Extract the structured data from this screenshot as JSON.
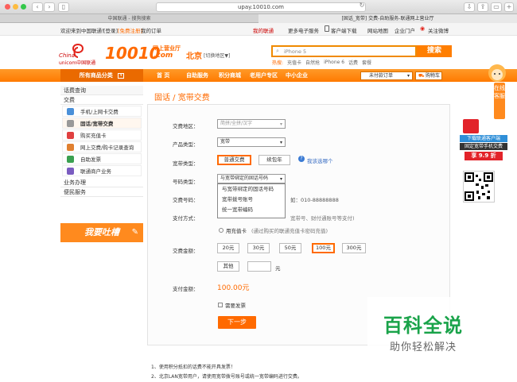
{
  "browser": {
    "url": "upay.10010.com",
    "tabs": [
      "中国联通 - 搜狗搜索",
      "[固话_宽带] 交费-自助服务-联通网上营业厅"
    ]
  },
  "toplinks": {
    "welcome": "欢迎来到中国联通！",
    "login": "[登录]",
    "register": "[免费注册]",
    "my_order": "我的订单",
    "my_unicom": "我的联通",
    "more_e_service": "更多电子服务",
    "client_download": "客户端下载",
    "site_map": "网站地图",
    "enterprise_portal": "企业门户",
    "weibo": "关注微博"
  },
  "header": {
    "logo_cn": "China",
    "logo_unicom": "unicom中国联通",
    "logo_10010": "10010",
    "logo_com": ".com",
    "logo_tagline": "网上营业厅",
    "city": "北京",
    "switch_city": "[切换地区▼]",
    "search_placeholder": "iPhone 5",
    "search_button": "搜索",
    "hot_label": "热搜:",
    "hot_words": [
      "充值卡",
      "自然抢",
      "iPhone 6",
      "话费",
      "套餐"
    ]
  },
  "mainnav": {
    "all_categories": "所有商品分类",
    "items": [
      "首  页",
      "自助服务",
      "积分商城",
      "老用户专区",
      "中小企业"
    ],
    "unpaid_orders": "未付款订单",
    "cart": "购物车"
  },
  "sidebar": {
    "section1": "话费查询",
    "section2": "交费",
    "items": [
      "手机/上网卡交费",
      "固话/宽带交费",
      "购买充值卡",
      "网上交费/购卡记录查询",
      "自助发票",
      "联通商户业务"
    ],
    "section3": "业务办理",
    "section4": "便民服务",
    "complain_banner": "我要吐槽"
  },
  "content": {
    "page_title": "固话 / 宽带交费",
    "area_label": "交费地区：",
    "area_placeholder": "简拼/全拼/汉字",
    "product_label": "产品类型：",
    "product_value": "宽带",
    "broadband_type_label": "宽带类型：",
    "broadband_types": [
      "普通交费",
      "续包年"
    ],
    "which_one": "我该选哪个",
    "number_type_label": "号码类型：",
    "number_type_value": "与宽带绑定的固话号码",
    "number_type_options": [
      "与宽带绑定的固话号码",
      "宽带拨号账号",
      "统一宽带编码"
    ],
    "pay_number_label": "交费号码：",
    "example": "如：010-88888888",
    "pay_method_label": "支付方式：",
    "pay_method_hint": "宽带号、财付通账号等支付)",
    "recharge_card": "用充值卡",
    "recharge_card_hint": "(通过购买的联通充值卡密码充值)",
    "amount_label": "交费金额：",
    "amounts": [
      "20元",
      "30元",
      "50元",
      "100元",
      "300元"
    ],
    "selected_amount": "100元",
    "other": "其他",
    "yuan": "元",
    "pay_total_label": "支付金额：",
    "pay_total": "100.00元",
    "invoice": "需要发票",
    "next_button": "下一步"
  },
  "notes": [
    "1、使用积分抵扣的话费不能开具发票！",
    "2、北京LAN宽带用户，请使用宽带拨号账号或统一宽带编码进行交费。"
  ],
  "right": {
    "online_service": "在线客服",
    "promo_line1": "下载联通客户端",
    "promo_line2": "固定宽带手机交费",
    "promo_line3": "享 9.9 折"
  },
  "watermark": {
    "title": "百科全说",
    "subtitle": "助你轻松解决"
  },
  "colors": {
    "brand_orange": "#ff6a00",
    "nav_orange": "#ff8a10"
  }
}
